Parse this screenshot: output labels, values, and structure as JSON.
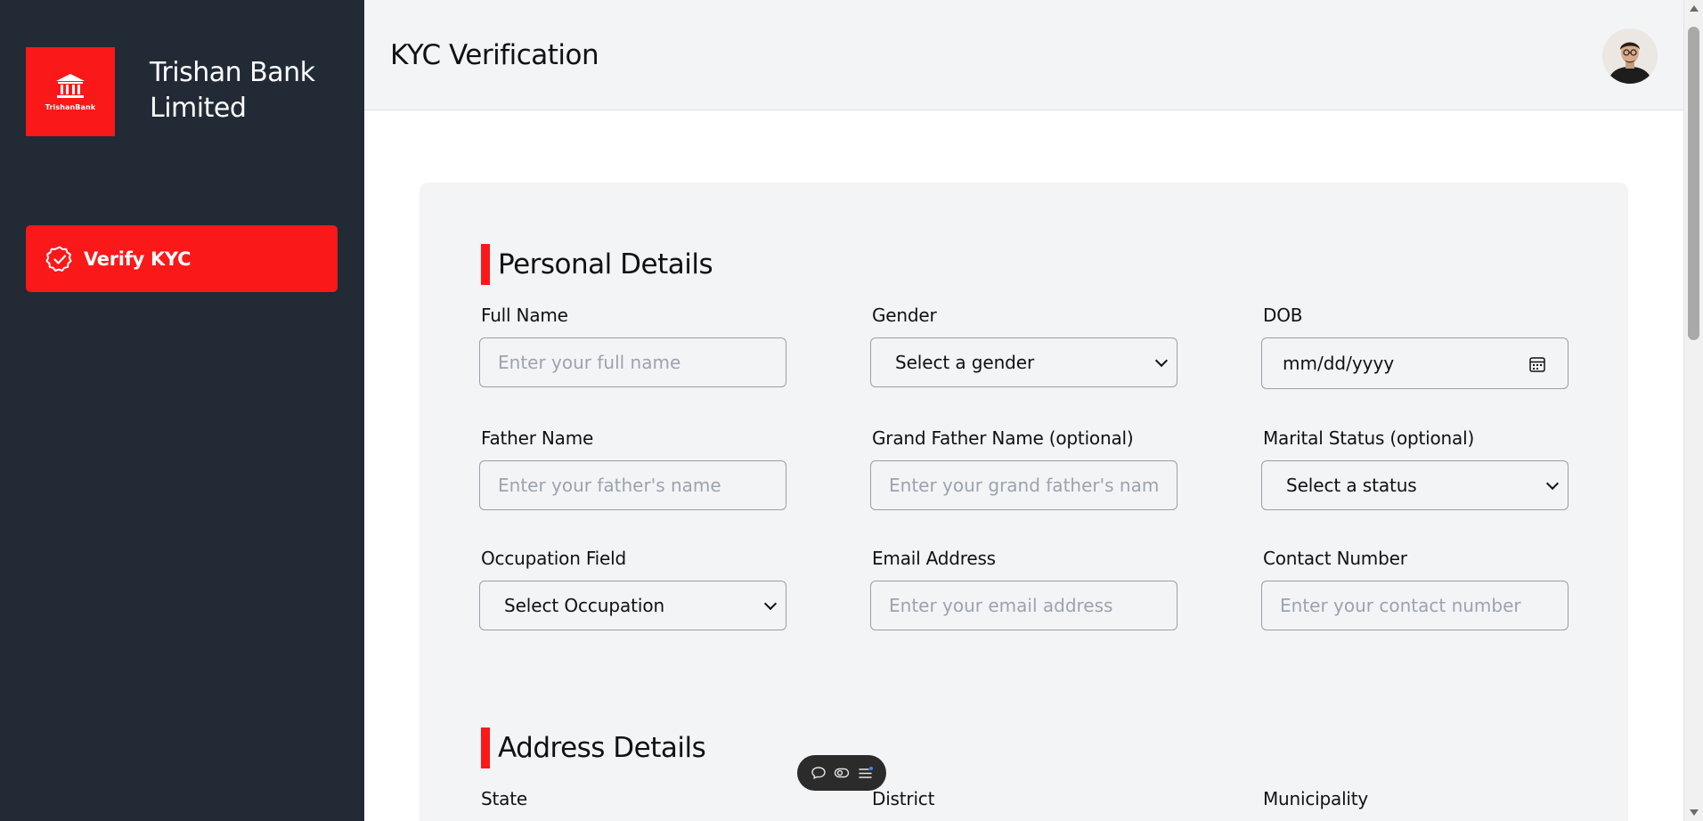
{
  "brand": {
    "logo_text": "TrishanBank",
    "name": "Trishan Bank Limited",
    "accent_color": "#fb1818",
    "sidebar_color": "#212a35"
  },
  "sidebar": {
    "items": [
      {
        "label": "Verify KYC",
        "icon": "badge-check-icon",
        "active": true
      }
    ]
  },
  "header": {
    "title": "KYC Verification",
    "avatar": "user-avatar"
  },
  "sections": {
    "personal": {
      "title": "Personal Details",
      "fields": {
        "full_name": {
          "label": "Full Name",
          "placeholder": "Enter your full name"
        },
        "gender": {
          "label": "Gender",
          "selected": "Select a gender"
        },
        "dob": {
          "label": "DOB",
          "placeholder": "mm/dd/yyyy"
        },
        "father_name": {
          "label": "Father Name",
          "placeholder": "Enter your father's name"
        },
        "grandfather_name": {
          "label": "Grand Father Name (optional)",
          "placeholder": "Enter your grand father's name"
        },
        "marital_status": {
          "label": "Marital Status (optional)",
          "selected": "Select a status"
        },
        "occupation": {
          "label": "Occupation Field",
          "selected": "Select Occupation"
        },
        "email": {
          "label": "Email Address",
          "placeholder": "Enter your email address"
        },
        "contact": {
          "label": "Contact Number",
          "placeholder": "Enter your contact number"
        }
      }
    },
    "address": {
      "title": "Address Details",
      "fields": {
        "state": {
          "label": "State"
        },
        "district": {
          "label": "District"
        },
        "municipality": {
          "label": "Municipality"
        }
      }
    }
  },
  "floating_toolbar": {
    "icons": [
      "chat-icon",
      "toggle-icon",
      "menu-notification-icon"
    ]
  }
}
